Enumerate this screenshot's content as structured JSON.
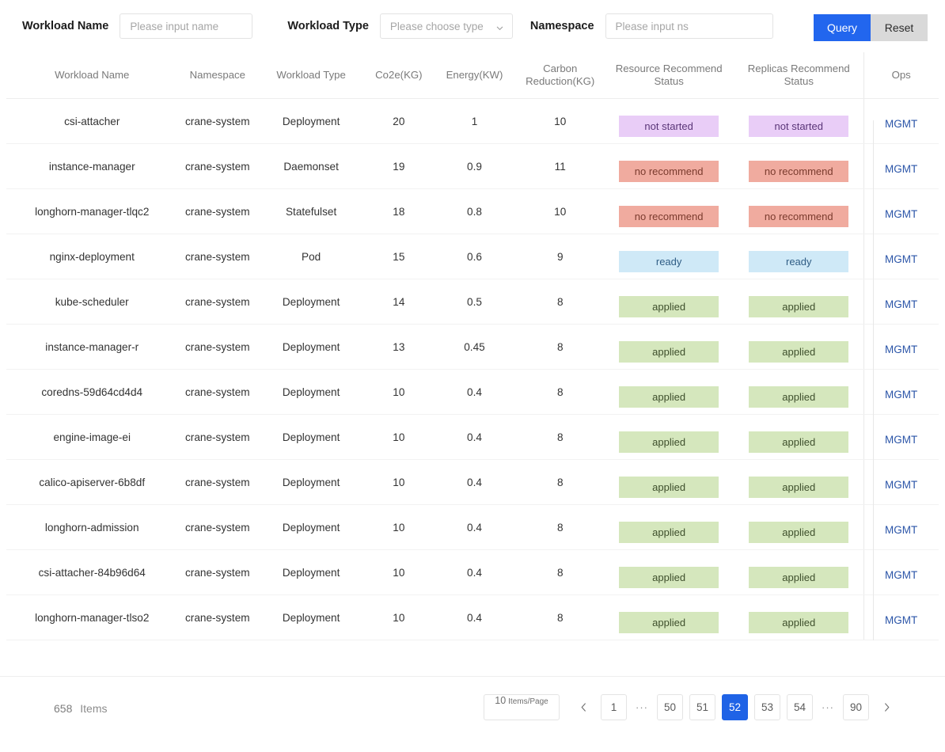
{
  "filter": {
    "workload_name_label": "Workload Name",
    "workload_name_placeholder": "Please input name",
    "workload_name_value": "",
    "workload_type_label": "Workload Type",
    "workload_type_placeholder": "Please choose type",
    "workload_type_value": "",
    "namespace_label": "Namespace",
    "namespace_placeholder": "Please input ns",
    "namespace_value": "",
    "query_button": "Query",
    "reset_button": "Reset",
    "query_color": "#2266ee",
    "reset_color": "#d9d9d9"
  },
  "table": {
    "columns": [
      {
        "key": "name",
        "label": "Workload Name"
      },
      {
        "key": "namespace",
        "label": "Namespace"
      },
      {
        "key": "type",
        "label": "Workload Type"
      },
      {
        "key": "co2e",
        "label": "Co2e(KG)"
      },
      {
        "key": "energy",
        "label": "Energy(KW)"
      },
      {
        "key": "carbon_reduction",
        "label": "Carbon Reduction(KG)"
      },
      {
        "key": "resource_status",
        "label": "Resource Recommend Status"
      },
      {
        "key": "replicas_status",
        "label": "Replicas Recommend Status"
      },
      {
        "key": "ops",
        "label": "Ops"
      }
    ],
    "ops_label": "MGMT",
    "status_colors": {
      "not started": "#e9cdf7",
      "no recommend": "#f0ab9f",
      "ready": "#cfe9f7",
      "applied": "#d5e7bd"
    },
    "rows": [
      {
        "name": "csi-attacher",
        "namespace": "crane-system",
        "type": "Deployment",
        "co2e": "20",
        "energy": "1",
        "carbon_reduction": "10",
        "resource_status": "not started",
        "replicas_status": "not started",
        "ops": "MGMT"
      },
      {
        "name": "instance-manager",
        "namespace": "crane-system",
        "type": "Daemonset",
        "co2e": "19",
        "energy": "0.9",
        "carbon_reduction": "11",
        "resource_status": "no recommend",
        "replicas_status": "no recommend",
        "ops": "MGMT"
      },
      {
        "name": "longhorn-manager-tlqc2",
        "namespace": "crane-system",
        "type": "Statefulset",
        "co2e": "18",
        "energy": "0.8",
        "carbon_reduction": "10",
        "resource_status": "no recommend",
        "replicas_status": "no recommend",
        "ops": "MGMT"
      },
      {
        "name": "nginx-deployment",
        "namespace": "crane-system",
        "type": "Pod",
        "co2e": "15",
        "energy": "0.6",
        "carbon_reduction": "9",
        "resource_status": "ready",
        "replicas_status": "ready",
        "ops": "MGMT"
      },
      {
        "name": "kube-scheduler",
        "namespace": "crane-system",
        "type": "Deployment",
        "co2e": "14",
        "energy": "0.5",
        "carbon_reduction": "8",
        "resource_status": "applied",
        "replicas_status": "applied",
        "ops": "MGMT"
      },
      {
        "name": "instance-manager-r",
        "namespace": "crane-system",
        "type": "Deployment",
        "co2e": "13",
        "energy": "0.45",
        "carbon_reduction": "8",
        "resource_status": "applied",
        "replicas_status": "applied",
        "ops": "MGMT"
      },
      {
        "name": "coredns-59d64cd4d4",
        "namespace": "crane-system",
        "type": "Deployment",
        "co2e": "10",
        "energy": "0.4",
        "carbon_reduction": "8",
        "resource_status": "applied",
        "replicas_status": "applied",
        "ops": "MGMT"
      },
      {
        "name": "engine-image-ei",
        "namespace": "crane-system",
        "type": "Deployment",
        "co2e": "10",
        "energy": "0.4",
        "carbon_reduction": "8",
        "resource_status": "applied",
        "replicas_status": "applied",
        "ops": "MGMT"
      },
      {
        "name": "calico-apiserver-6b8df",
        "namespace": "crane-system",
        "type": "Deployment",
        "co2e": "10",
        "energy": "0.4",
        "carbon_reduction": "8",
        "resource_status": "applied",
        "replicas_status": "applied",
        "ops": "MGMT"
      },
      {
        "name": "longhorn-admission",
        "namespace": "crane-system",
        "type": "Deployment",
        "co2e": "10",
        "energy": "0.4",
        "carbon_reduction": "8",
        "resource_status": "applied",
        "replicas_status": "applied",
        "ops": "MGMT"
      },
      {
        "name": "csi-attacher-84b96d64",
        "namespace": "crane-system",
        "type": "Deployment",
        "co2e": "10",
        "energy": "0.4",
        "carbon_reduction": "8",
        "resource_status": "applied",
        "replicas_status": "applied",
        "ops": "MGMT"
      },
      {
        "name": "longhorn-manager-tlso2",
        "namespace": "crane-system",
        "type": "Deployment",
        "co2e": "10",
        "energy": "0.4",
        "carbon_reduction": "8",
        "resource_status": "applied",
        "replicas_status": "applied",
        "ops": "MGMT"
      }
    ]
  },
  "footer": {
    "total_count": "658",
    "total_label": "Items",
    "page_size_number": "10",
    "page_size_unit": "Items/Page",
    "prev_label": "‹",
    "next_label": "›",
    "pages": [
      {
        "label": "1",
        "type": "page",
        "active": false
      },
      {
        "label": "···",
        "type": "ellipsis",
        "active": false
      },
      {
        "label": "50",
        "type": "page",
        "active": false
      },
      {
        "label": "51",
        "type": "page",
        "active": false
      },
      {
        "label": "52",
        "type": "page",
        "active": true
      },
      {
        "label": "53",
        "type": "page",
        "active": false
      },
      {
        "label": "54",
        "type": "page",
        "active": false
      },
      {
        "label": "···",
        "type": "ellipsis",
        "active": false
      },
      {
        "label": "90",
        "type": "page",
        "active": false
      }
    ],
    "active_page_color": "#1f63e6"
  }
}
